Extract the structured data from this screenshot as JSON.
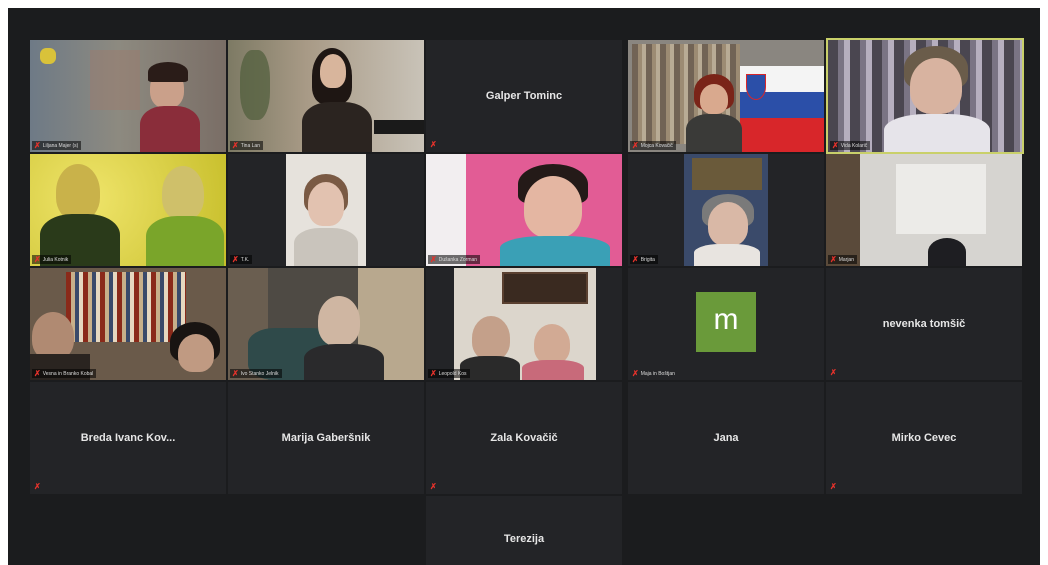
{
  "participants": [
    {
      "name": "Liljana Majer (s)",
      "type": "video"
    },
    {
      "name": "Tina Lan",
      "type": "video"
    },
    {
      "name": "Galper Tominc",
      "type": "name"
    },
    {
      "name": "Mojca Kovačič",
      "type": "video"
    },
    {
      "name": "Vida Kolarič",
      "type": "video",
      "active": true
    },
    {
      "name": "Julia Kotnik",
      "type": "video"
    },
    {
      "name": "T.K.",
      "type": "video"
    },
    {
      "name": "Dušanka Zorman",
      "type": "video"
    },
    {
      "name": "Brigita",
      "type": "video"
    },
    {
      "name": "Marjan",
      "type": "video"
    },
    {
      "name": "Vesna in Branko Kobal",
      "type": "video"
    },
    {
      "name": "Ivo Stanko Jelnik",
      "type": "video"
    },
    {
      "name": "Leopold Kos",
      "type": "video"
    },
    {
      "name": "Maja in Boštjan",
      "type": "avatar",
      "avatar_letter": "m",
      "avatar_color": "#6a9a3a"
    },
    {
      "name": "nevenka tomšič",
      "type": "name"
    },
    {
      "name": "Breda Ivanc Kov...",
      "type": "name"
    },
    {
      "name": "Marija Gaberšnik",
      "type": "name"
    },
    {
      "name": "Zala Kovačič",
      "type": "name"
    },
    {
      "name": "Jana",
      "type": "name"
    },
    {
      "name": "Mirko Cevec",
      "type": "name"
    },
    {
      "name": "Terezija",
      "type": "name"
    }
  ],
  "icons": {
    "muted": "mic-off-icon"
  },
  "colors": {
    "background": "#1b1c1e",
    "tile": "#232427",
    "active_speaker_border": "#c9d06a",
    "muted": "#e5322b"
  }
}
